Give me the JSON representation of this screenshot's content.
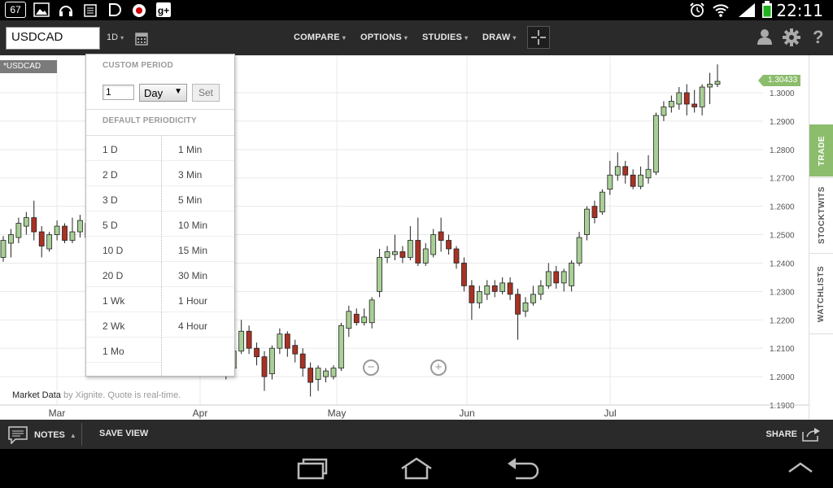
{
  "status_bar": {
    "notification_count": "67",
    "time": "22:11",
    "icons": [
      "badge-67-icon",
      "image-icon",
      "headphones-icon",
      "newsstand-icon",
      "d-app-icon",
      "camera-app-icon",
      "google-plus-icon",
      "alarm-icon",
      "wifi-icon",
      "signal-icon",
      "battery-icon"
    ]
  },
  "toolbar": {
    "symbol": "USDCAD",
    "period": "1D",
    "menus": [
      "COMPARE",
      "OPTIONS",
      "STUDIES",
      "DRAW"
    ]
  },
  "chart": {
    "symbol_tag": "*USDCAD",
    "last_price": "1.30433",
    "market_data_label": "Market Data",
    "market_data_note": " by Xignite. Quote is real-time.",
    "zoom_out": "−",
    "zoom_in": "+",
    "x_labels": [
      "Mar",
      "Apr",
      "May",
      "Jun",
      "Jul"
    ],
    "y_labels": [
      "1.3000",
      "1.2900",
      "1.2800",
      "1.2700",
      "1.2600",
      "1.2500",
      "1.2400",
      "1.2300",
      "1.2200",
      "1.2100",
      "1.2000",
      "1.1900"
    ]
  },
  "side_tabs": [
    "TRADE",
    "STOCKTWITS",
    "WATCHLISTS"
  ],
  "dropdown": {
    "custom_heading": "CUSTOM PERIOD",
    "custom_value": "1",
    "custom_unit": "Day",
    "set_label": "Set",
    "default_heading": "DEFAULT PERIODICITY",
    "left_items": [
      "1 D",
      "2 D",
      "3 D",
      "5 D",
      "10 D",
      "20 D",
      "1 Wk",
      "2 Wk",
      "1 Mo"
    ],
    "right_items": [
      "1 Min",
      "3 Min",
      "5 Min",
      "10 Min",
      "15 Min",
      "30 Min",
      "1 Hour",
      "4 Hour"
    ]
  },
  "bottom_bar": {
    "notes": "NOTES",
    "save_view": "SAVE VIEW",
    "share": "SHARE"
  },
  "colors": {
    "up_candle": "#a8cf96",
    "down_candle": "#a83224",
    "accent_green": "#8cbd6c",
    "toolbar_bg": "#2a2a2a"
  },
  "nav_bar": [
    "recent-apps-icon",
    "home-icon",
    "back-icon",
    "chevron-up-icon"
  ]
}
